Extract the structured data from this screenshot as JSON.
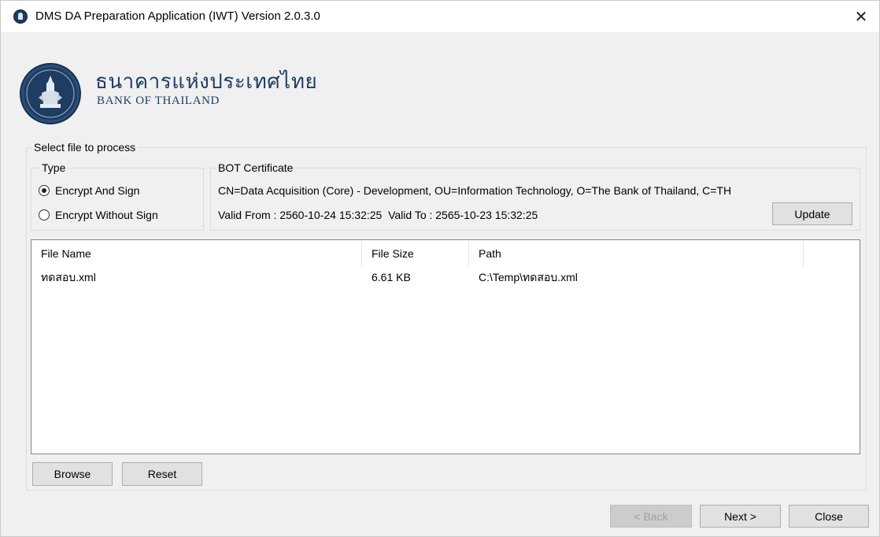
{
  "window": {
    "title": "DMS DA Preparation Application (IWT) Version 2.0.3.0",
    "close_glyph": "✕"
  },
  "logo": {
    "thai_name": "ธนาคารแห่งประเทศไทย",
    "english_name": "BANK OF THAILAND"
  },
  "select_group": {
    "label": "Select file to process"
  },
  "type_group": {
    "label": "Type",
    "options": [
      {
        "label": "Encrypt And Sign",
        "checked": true
      },
      {
        "label": "Encrypt Without Sign",
        "checked": false
      }
    ]
  },
  "certificate_group": {
    "label": "BOT Certificate",
    "subject": "CN=Data Acquisition (Core) - Development, OU=Information Technology, O=The Bank of Thailand, C=TH",
    "validity": "Valid From : 2560-10-24 15:32:25  Valid To : 2565-10-23 15:32:25",
    "update_label": "Update"
  },
  "file_list": {
    "columns": [
      "File Name",
      "File Size",
      "Path"
    ],
    "rows": [
      {
        "name": "ทดสอบ.xml",
        "size": "6.61 KB",
        "path": "C:\\Temp\\ทดสอบ.xml"
      }
    ]
  },
  "actions": {
    "browse_label": "Browse",
    "reset_label": "Reset"
  },
  "wizard": {
    "back_label": "< Back",
    "next_label": "Next >",
    "close_label": "Close"
  },
  "colors": {
    "brand": "#1f3d63",
    "window_bg": "#f0f0f0",
    "button_bg": "#e1e1e1"
  }
}
